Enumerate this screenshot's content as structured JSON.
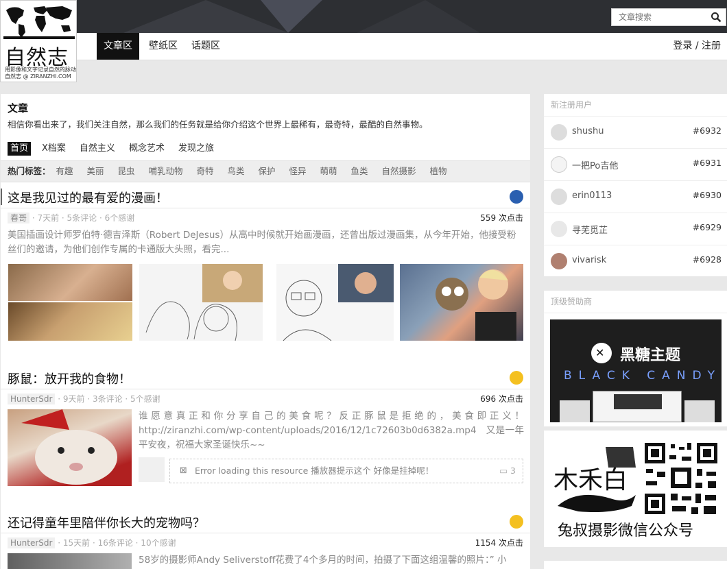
{
  "logo": {
    "title": "自然志",
    "sub1": "用影像和文字记录自然的脉动",
    "sub2": "自然志 @ ZIRANZHI.COM"
  },
  "search": {
    "placeholder": "文章搜索"
  },
  "nav": {
    "items": [
      "文章区",
      "壁纸区",
      "话题区"
    ],
    "active": 0,
    "login": "登录 / 注册"
  },
  "section": {
    "title": "文章",
    "desc": "相信你看出来了，我们关注自然，那么我们的任务就是给你介绍这个世界上最稀有，最奇特，最酷的自然事物。",
    "subnav": [
      "首页",
      "X档案",
      "自然主义",
      "概念艺术",
      "发现之旅"
    ],
    "tags_label": "热门标签：",
    "tags": [
      "有趣",
      "美丽",
      "昆虫",
      "哺乳动物",
      "奇特",
      "鸟类",
      "保护",
      "怪异",
      "萌萌",
      "鱼类",
      "自然摄影",
      "植物"
    ]
  },
  "posts": [
    {
      "title": "这是我见过的最有爱的漫画！",
      "author": "春哥",
      "meta": " · 7天前 · 5条评论 · 6个感谢",
      "clicks": "559 次点击",
      "excerpt": "美国插画设计师罗伯特·德吉泽斯（Robert DeJesus）从高中时候就开始画漫画，还曾出版过漫画集，从今年开始，他接受粉丝们的邀请，为他们创作专属的卡通版大头照，看完..."
    },
    {
      "title": "豚鼠：放开我的食物！",
      "author": "HunterSdr",
      "meta": " · 9天前 · 3条评论 · 5个感谢",
      "clicks": "696 次点击",
      "excerpt": "谁愿意真正和你分享自己的美食呢？反正豚鼠是拒绝的，美食即正义！http://ziranzhi.com/wp-content/uploads/2016/12/1c72603b0d6382a.mp4　又是一年平安夜，祝福大家圣诞快乐~~",
      "embed_text": "Error loading this resource 播放器提示这个 好像是挂掉呢！",
      "embed_count": "3"
    },
    {
      "title": "还记得童年里陪伴你长大的宠物吗？",
      "author": "HunterSdr",
      "meta": " · 15天前 · 16条评论 · 10个感谢",
      "clicks": "1154 次点击",
      "excerpt": "58岁的摄影师Andy Seliverstoff花费了4个多月的时间，拍摄了下面这组温馨的照片：” 小"
    }
  ],
  "sidebar": {
    "new_users_title": "新注册用户",
    "users": [
      {
        "name": "shushu",
        "num": "#6932"
      },
      {
        "name": "一把Po吉他",
        "num": "#6931"
      },
      {
        "name": "erin0113",
        "num": "#6930"
      },
      {
        "name": "寻芜觅芷",
        "num": "#6929"
      },
      {
        "name": "vivarisk",
        "num": "#6928"
      }
    ],
    "sponsor_title": "顶级赞助商",
    "sponsor_brand": "黑糖主题",
    "sponsor_sub": "BLACK CANDY",
    "wechat_caption": "兔叔摄影微信公众号",
    "wechat_logo_text": "木禾白"
  }
}
